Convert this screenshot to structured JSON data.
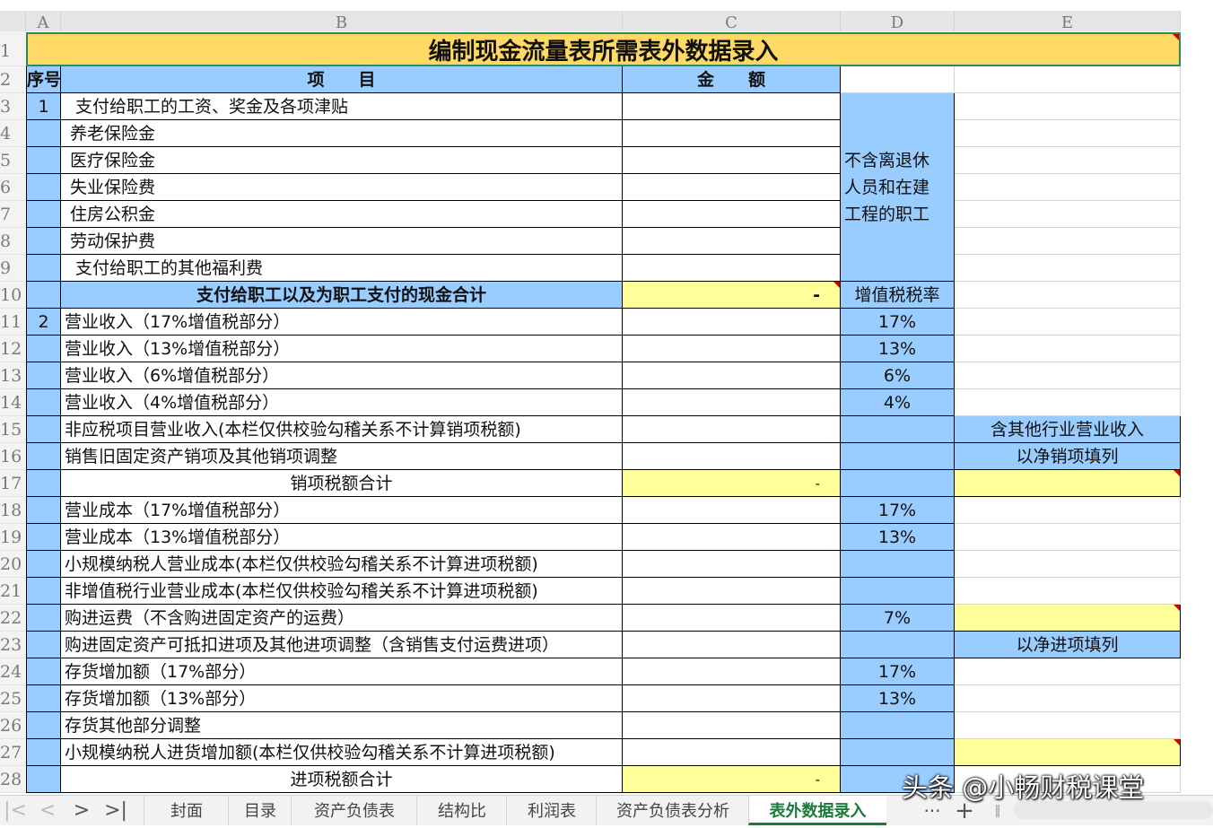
{
  "columns": [
    "A",
    "B",
    "C",
    "D",
    "E"
  ],
  "title": "编制现金流量表所需表外数据录入",
  "header": {
    "seq": "序号",
    "item": "项　　目",
    "amount": "金　　额"
  },
  "rows": [
    {
      "n": "3",
      "seq": "1",
      "item": "支付给职工的工资、奖金及各项津贴"
    },
    {
      "n": "4",
      "item": "养老保险金"
    },
    {
      "n": "5",
      "item": "医疗保险金"
    },
    {
      "n": "6",
      "item": "失业保险费"
    },
    {
      "n": "7",
      "item": "住房公积金"
    },
    {
      "n": "8",
      "item": "劳动保护费"
    },
    {
      "n": "9",
      "item": "支付给职工的其他福利费"
    },
    {
      "n": "10",
      "item": "支付给职工以及为职工支付的现金合计",
      "amount": "-",
      "d": "增值税税率"
    },
    {
      "n": "11",
      "seq": "2",
      "item": "营业收入（17%增值税部分）",
      "d": "17%"
    },
    {
      "n": "12",
      "item": "营业收入（13%增值税部分）",
      "d": "13%"
    },
    {
      "n": "13",
      "item": "营业收入（6%增值税部分）",
      "d": "6%"
    },
    {
      "n": "14",
      "item": "营业收入（4%增值税部分）",
      "d": "4%"
    },
    {
      "n": "15",
      "item": "非应税项目营业收入(本栏仅供校验勾稽关系不计算销项税额)",
      "e": "含其他行业营业收入"
    },
    {
      "n": "16",
      "item": "销售旧固定资产销项及其他销项调整",
      "e": "以净销项填列"
    },
    {
      "n": "17",
      "item": "销项税额合计",
      "amount": "-"
    },
    {
      "n": "18",
      "item": "营业成本（17%增值税部分）",
      "d": "17%"
    },
    {
      "n": "19",
      "item": "营业成本（13%增值税部分）",
      "d": "13%"
    },
    {
      "n": "20",
      "item": "小规模纳税人营业成本(本栏仅供校验勾稽关系不计算进项税额)"
    },
    {
      "n": "21",
      "item": "非增值税行业营业成本(本栏仅供校验勾稽关系不计算进项税额)"
    },
    {
      "n": "22",
      "item": "购进运费（不含购进固定资产的运费）",
      "d": "7%"
    },
    {
      "n": "23",
      "item": "购进固定资产可抵扣进项及其他进项调整（含销售支付运费进项）",
      "e": "以净进项填列"
    },
    {
      "n": "24",
      "item": "存货增加额（17%部分）",
      "d": "17%"
    },
    {
      "n": "25",
      "item": "存货增加额（13%部分）",
      "d": "13%"
    },
    {
      "n": "26",
      "item": "存货其他部分调整"
    },
    {
      "n": "27",
      "item": "小规模纳税人进货增加额(本栏仅供校验勾稽关系不计算进项税额)"
    },
    {
      "n": "28",
      "item": "进项税额合计",
      "amount": "-"
    }
  ],
  "d_note": "不含离退休人员和在建工程的职工",
  "d_note_lines": [
    "不含离退休",
    "人员和在建",
    "工程的职工"
  ],
  "row_numbers": [
    "1",
    "2"
  ],
  "tabs": [
    "封面",
    "目录",
    "资产负债表",
    "结构比",
    "利润表",
    "资产负债表分析",
    "表外数据录入"
  ],
  "active_tab": "表外数据录入",
  "tab_more": "···",
  "tab_add": "+",
  "watermark": "头条 @小畅财税课堂",
  "colors": {
    "blue": "#99ccff",
    "yellow": "#ffff99",
    "title": "#ffd966",
    "active_tab": "#1a7a3a"
  }
}
